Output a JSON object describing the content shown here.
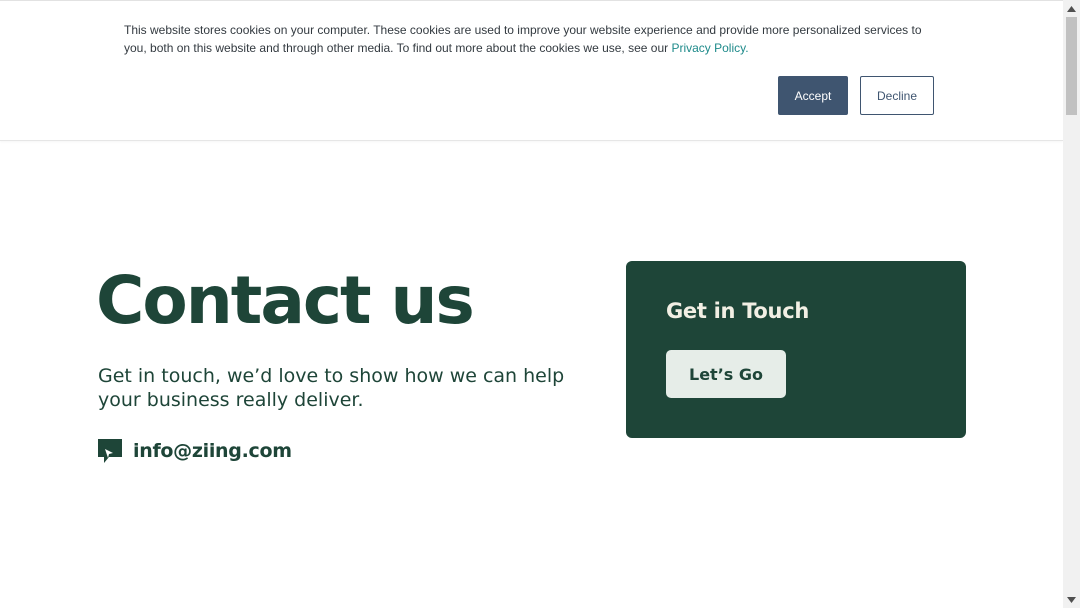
{
  "cookie_banner": {
    "text": "This website stores cookies on your computer. These cookies are used to improve your website experience and provide more personalized services to you, both on this website and through other media. To find out more about the cookies we use, see our ",
    "link_text": "Privacy Policy.",
    "accept_label": "Accept",
    "decline_label": "Decline"
  },
  "main": {
    "title": "Contact us",
    "subtitle": "Get in touch, we’d love to show how we can help your business really deliver.",
    "email": "info@ziing.com",
    "email_icon": "chat-icon"
  },
  "card": {
    "title": "Get in Touch",
    "button_label": "Let’s Go"
  },
  "colors": {
    "brand_green": "#1e4538",
    "accept_button": "#3f5570",
    "link": "#1e8a8a",
    "card_button_bg": "#e6ede8"
  }
}
